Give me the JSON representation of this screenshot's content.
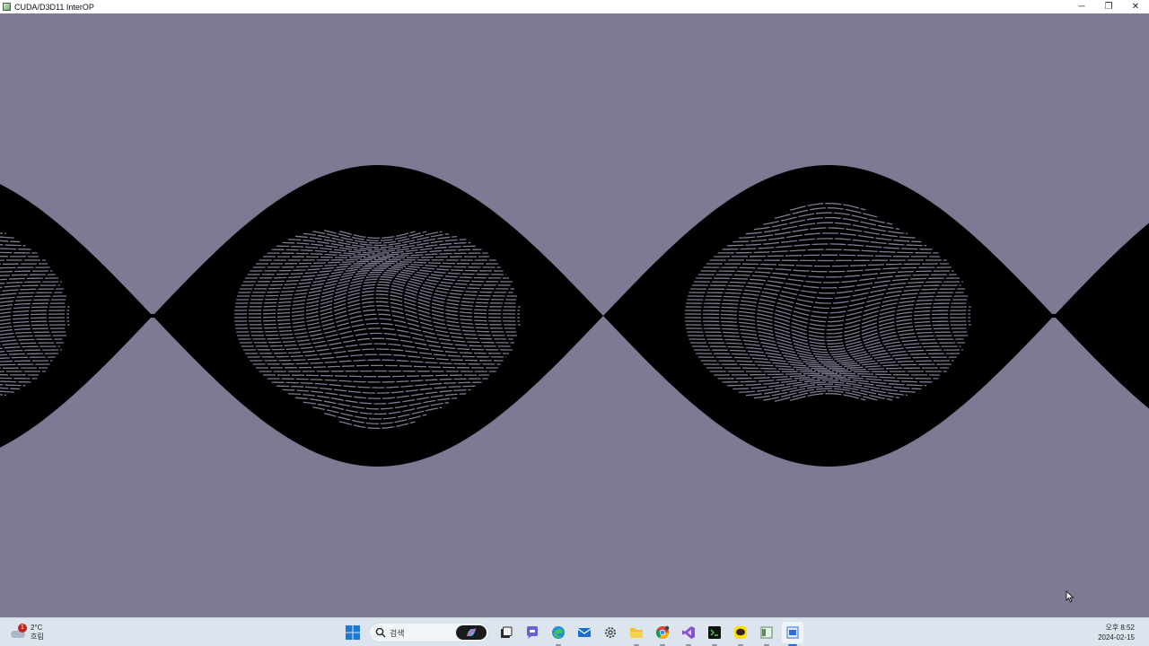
{
  "window": {
    "title": "CUDA/D3D11 InterOP",
    "controls": {
      "minimize": "─",
      "restore": "❐",
      "close": "✕"
    }
  },
  "render": {
    "background_color": "#7c7b93",
    "wave_color": "#000000",
    "interference_color": "#7c7b93"
  },
  "taskbar": {
    "weather": {
      "temperature": "2°C",
      "condition": "흐림",
      "badge_count": "1"
    },
    "search": {
      "placeholder": "검색"
    },
    "apps": [
      {
        "name": "start-icon"
      },
      {
        "name": "search-icon"
      },
      {
        "name": "copilot-icon"
      },
      {
        "name": "task-view-icon"
      },
      {
        "name": "teams-chat-icon"
      },
      {
        "name": "edge-icon"
      },
      {
        "name": "mail-icon"
      },
      {
        "name": "settings-icon"
      },
      {
        "name": "file-explorer-icon"
      },
      {
        "name": "chrome-icon"
      },
      {
        "name": "visual-studio-icon"
      },
      {
        "name": "terminal-icon"
      },
      {
        "name": "kakaotalk-icon"
      },
      {
        "name": "app-window-icon"
      },
      {
        "name": "cuda-app-icon"
      }
    ],
    "clock": {
      "time": "오후 8:52",
      "date": "2024-02-15"
    }
  }
}
